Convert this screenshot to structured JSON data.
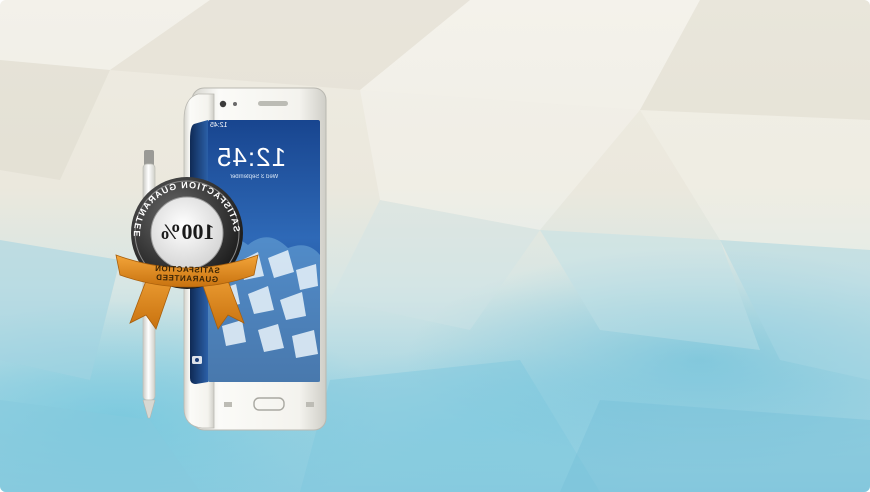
{
  "phone": {
    "status_time": "12:45",
    "clock": "12:45",
    "date": "Wed 3 September"
  },
  "badge": {
    "percent": "100%",
    "ring_text": "SATISFACTION GUARANTEED",
    "ribbon_text": "SATISFACTION GUARANTEED"
  },
  "colors": {
    "ribbon": "#e08a1e",
    "screen": "#1e4f9a",
    "sky": "#8fcde0"
  }
}
